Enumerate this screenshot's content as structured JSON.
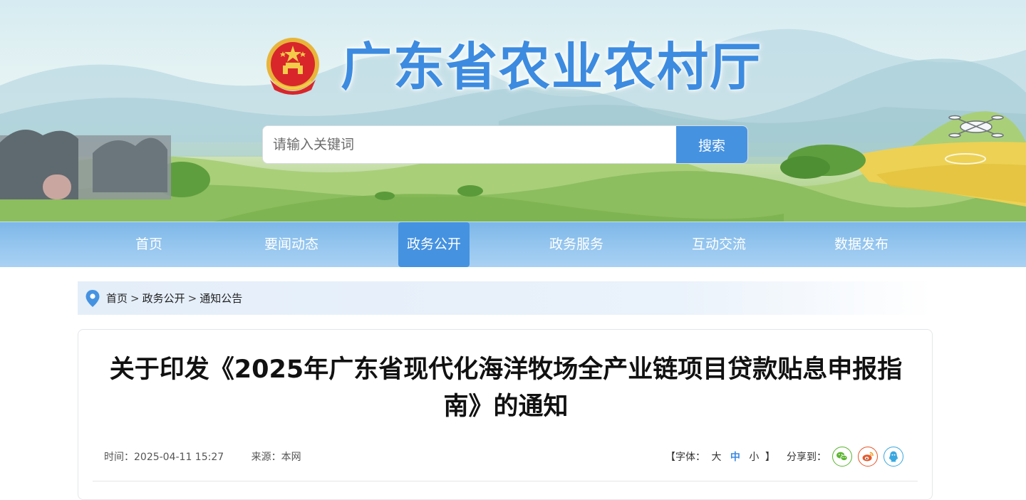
{
  "header": {
    "site_title": "广东省农业农村厅",
    "search_placeholder": "请输入关键词",
    "search_button": "搜索"
  },
  "nav": {
    "items": [
      {
        "label": "首页"
      },
      {
        "label": "要闻动态"
      },
      {
        "label": "政务公开"
      },
      {
        "label": "政务服务"
      },
      {
        "label": "互动交流"
      },
      {
        "label": "数据发布"
      }
    ],
    "active": "政务公开"
  },
  "breadcrumb": {
    "items": [
      "首页",
      "政务公开",
      "通知公告"
    ],
    "separator": ">"
  },
  "article": {
    "title": "关于印发《2025年广东省现代化海洋牧场全产业链项目贷款贴息申报指南》的通知",
    "time_label": "时间：",
    "time": "2025-04-11 15:27",
    "source_label": "来源：",
    "source": "本网",
    "font_size": {
      "open": "【字体：",
      "large": "大",
      "medium": "中",
      "small": "小",
      "close": "】"
    },
    "share_label": "分享到：",
    "share_icons": [
      "wechat-icon",
      "weibo-icon",
      "qq-icon"
    ]
  },
  "colors": {
    "accent": "#4592e1",
    "title_blue": "#3c8be0",
    "wechat": "#5cb531",
    "weibo": "#e8582a",
    "qq": "#3aa8e0"
  }
}
